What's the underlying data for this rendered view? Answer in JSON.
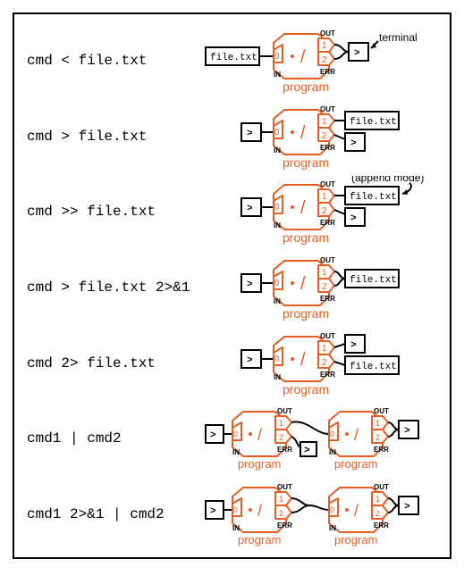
{
  "rows": [
    {
      "cmd": "cmd < file.txt"
    },
    {
      "cmd": "cmd > file.txt"
    },
    {
      "cmd": "cmd >> file.txt"
    },
    {
      "cmd": "cmd > file.txt 2>&1"
    },
    {
      "cmd": "cmd 2> file.txt"
    },
    {
      "cmd": "cmd1 | cmd2"
    },
    {
      "cmd": "cmd1 2>&1 | cmd2"
    }
  ],
  "file_label": "file.txt",
  "terminal_glyph": ">",
  "prog_label": "program",
  "labels": {
    "in": "IN",
    "out": "OUT",
    "err": "ERR",
    "fd0": "0",
    "fd1": "1",
    "fd2": "2",
    "dot": "•",
    "slash": "/"
  },
  "annotations": {
    "terminal": "terminal",
    "append": "(append mode)"
  }
}
